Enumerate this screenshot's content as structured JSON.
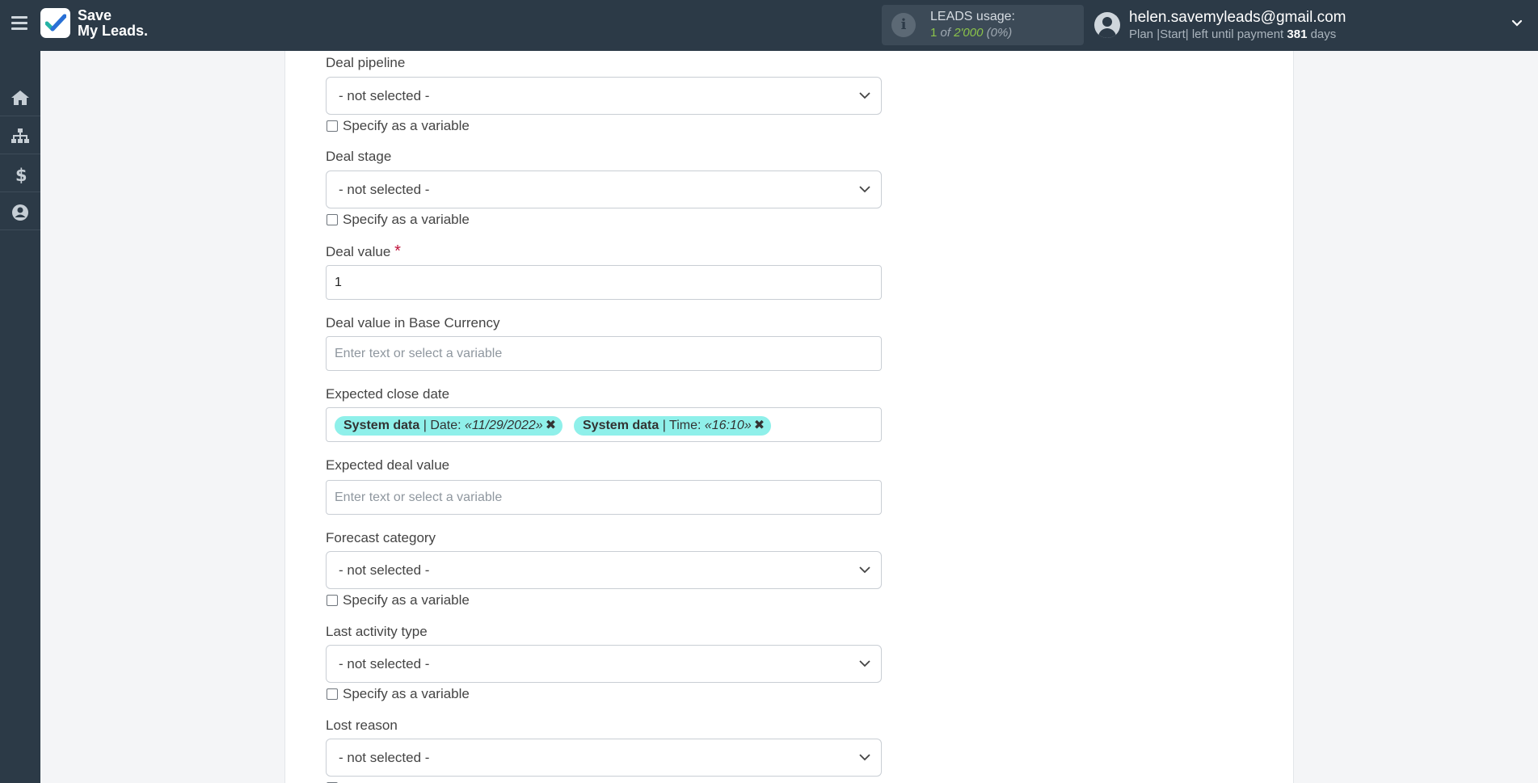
{
  "brand": {
    "line1": "Save",
    "line2": "My Leads."
  },
  "leads_usage": {
    "label": "LEADS usage:",
    "used": "1",
    "of_text": " of ",
    "total": "2'000",
    "percent": "(0%)"
  },
  "user": {
    "email": "helen.savemyleads@gmail.com",
    "plan_prefix": "Plan |Start| left until payment ",
    "days": "381",
    "days_suffix": " days"
  },
  "sidebar": {
    "items": [
      "home-icon",
      "sitemap-icon",
      "dollar-icon",
      "user-circle-icon"
    ]
  },
  "colors": {
    "topbar": "#2c3a47",
    "tag_bg": "#8ff0ea",
    "required": "#c0143c",
    "usage_accent": "#8bc34a"
  },
  "form": {
    "deal_pipeline": {
      "label": "Deal pipeline",
      "value": "- not selected -",
      "variable_label": "Specify as a variable"
    },
    "deal_stage": {
      "label": "Deal stage",
      "value": "- not selected -",
      "variable_label": "Specify as a variable"
    },
    "deal_value": {
      "label": "Deal value",
      "required_mark": "*",
      "value": "1"
    },
    "deal_value_base": {
      "label": "Deal value in Base Currency",
      "placeholder": "Enter text or select a variable"
    },
    "expected_close_date": {
      "label": "Expected close date",
      "tags": [
        {
          "source": "System data",
          "field": " | Date: ",
          "value": "«11/29/2022»"
        },
        {
          "source": "System data",
          "field": " | Time: ",
          "value": "«16:10»"
        }
      ]
    },
    "expected_deal_value": {
      "label": "Expected deal value",
      "placeholder": "Enter text or select a variable"
    },
    "forecast_category": {
      "label": "Forecast category",
      "value": "- not selected -",
      "variable_label": "Specify as a variable"
    },
    "last_activity_type": {
      "label": "Last activity type",
      "value": "- not selected -",
      "variable_label": "Specify as a variable"
    },
    "lost_reason": {
      "label": "Lost reason",
      "value": "- not selected -"
    }
  }
}
